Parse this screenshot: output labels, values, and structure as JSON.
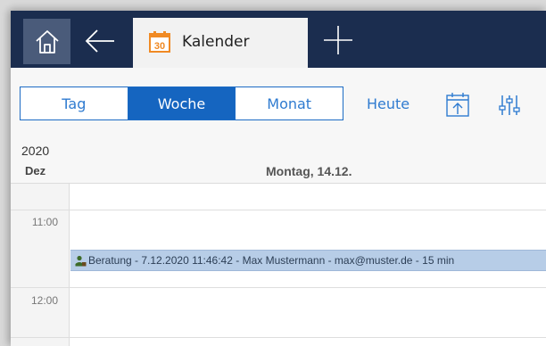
{
  "topbar": {
    "tab": {
      "label": "Kalender",
      "icon_day": "30"
    },
    "icons": {
      "home": "home-icon",
      "back": "arrow-left-icon",
      "add": "plus-icon"
    },
    "colors": {
      "bar": "#1b2d4f",
      "home_bg": "#4a5b7a",
      "calendar_icon": "#f08a24"
    }
  },
  "toolbar": {
    "views": [
      {
        "label": "Tag",
        "active": false
      },
      {
        "label": "Woche",
        "active": true
      },
      {
        "label": "Monat",
        "active": false
      }
    ],
    "today_label": "Heute",
    "icons": {
      "export": "calendar-export-icon",
      "filter": "sliders-icon"
    },
    "colors": {
      "accent": "#1565c0"
    }
  },
  "calendar": {
    "year": "2020",
    "month": "Dez",
    "day_header": "Montag, 14.12.",
    "times": [
      "11:00",
      "12:00"
    ],
    "event": {
      "icon": "user-icon",
      "text": "Beratung - 7.12.2020 11:46:42 - Max Mustermann - max@muster.de - 15 min",
      "color": "#b7cde7"
    }
  }
}
